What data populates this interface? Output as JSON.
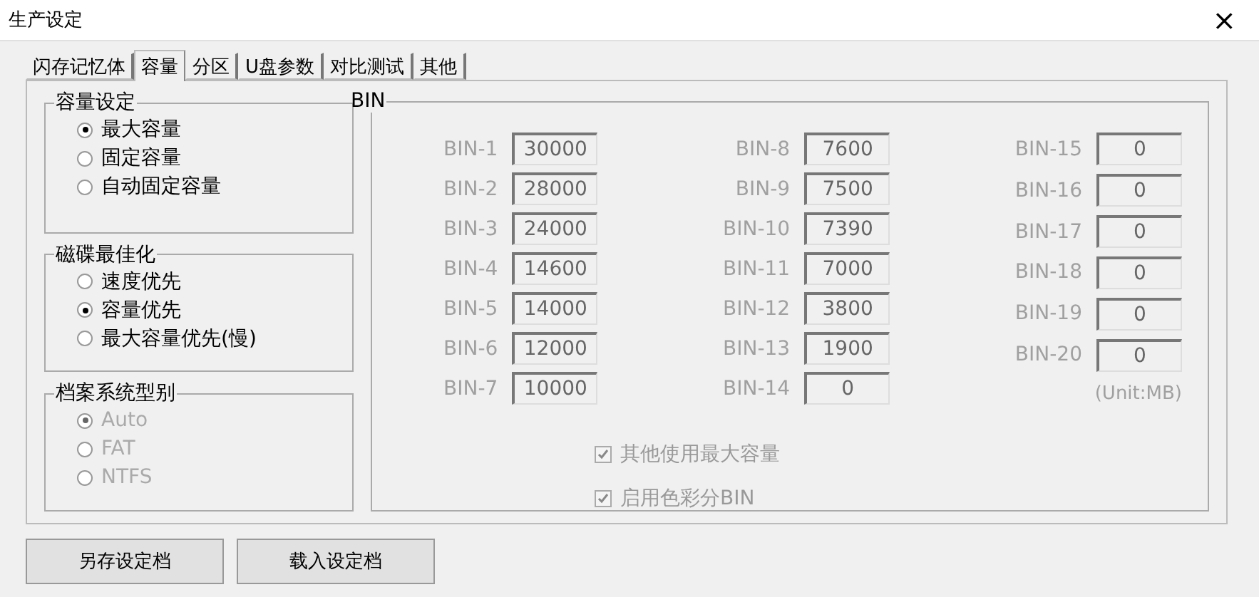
{
  "window": {
    "title": "生产设定",
    "close": "×"
  },
  "tabs": [
    {
      "label": "闪存记忆体",
      "selected": false
    },
    {
      "label": "容量",
      "selected": true
    },
    {
      "label": "分区",
      "selected": false
    },
    {
      "label": "U盘参数",
      "selected": false
    },
    {
      "label": "对比测试",
      "selected": false
    },
    {
      "label": "其他",
      "selected": false
    }
  ],
  "groups": [
    {
      "title": "容量设定",
      "disabled": false,
      "options": [
        {
          "label": "最大容量",
          "selected": true
        },
        {
          "label": "固定容量",
          "selected": false
        },
        {
          "label": "自动固定容量",
          "selected": false
        }
      ]
    },
    {
      "title": "磁碟最佳化",
      "disabled": false,
      "options": [
        {
          "label": "速度优先",
          "selected": false
        },
        {
          "label": "容量优先",
          "selected": true
        },
        {
          "label": "最大容量优先(慢)",
          "selected": false
        }
      ]
    },
    {
      "title": "档案系统型别",
      "disabled": true,
      "options": [
        {
          "label": "Auto",
          "selected": true
        },
        {
          "label": "FAT",
          "selected": false
        },
        {
          "label": "NTFS",
          "selected": false
        }
      ]
    }
  ],
  "bin": {
    "title": "BIN",
    "columns": [
      [
        {
          "label": "BIN-1",
          "value": "30000"
        },
        {
          "label": "BIN-2",
          "value": "28000"
        },
        {
          "label": "BIN-3",
          "value": "24000"
        },
        {
          "label": "BIN-4",
          "value": "14600"
        },
        {
          "label": "BIN-5",
          "value": "14000"
        },
        {
          "label": "BIN-6",
          "value": "12000"
        },
        {
          "label": "BIN-7",
          "value": "10000"
        }
      ],
      [
        {
          "label": "BIN-8",
          "value": "7600"
        },
        {
          "label": "BIN-9",
          "value": "7500"
        },
        {
          "label": "BIN-10",
          "value": "7390"
        },
        {
          "label": "BIN-11",
          "value": "7000"
        },
        {
          "label": "BIN-12",
          "value": "3800"
        },
        {
          "label": "BIN-13",
          "value": "1900"
        },
        {
          "label": "BIN-14",
          "value": "0"
        }
      ],
      [
        {
          "label": "BIN-15",
          "value": "0"
        },
        {
          "label": "BIN-16",
          "value": "0"
        },
        {
          "label": "BIN-17",
          "value": "0"
        },
        {
          "label": "BIN-18",
          "value": "0"
        },
        {
          "label": "BIN-19",
          "value": "0"
        },
        {
          "label": "BIN-20",
          "value": "0"
        }
      ]
    ],
    "unit": "(Unit:MB)",
    "checkboxes": [
      {
        "label": "其他使用最大容量",
        "checked": true,
        "disabled": true
      },
      {
        "label": "启用色彩分BIN",
        "checked": true,
        "disabled": true
      }
    ]
  },
  "buttons": [
    "另存设定档",
    "载入设定档"
  ]
}
